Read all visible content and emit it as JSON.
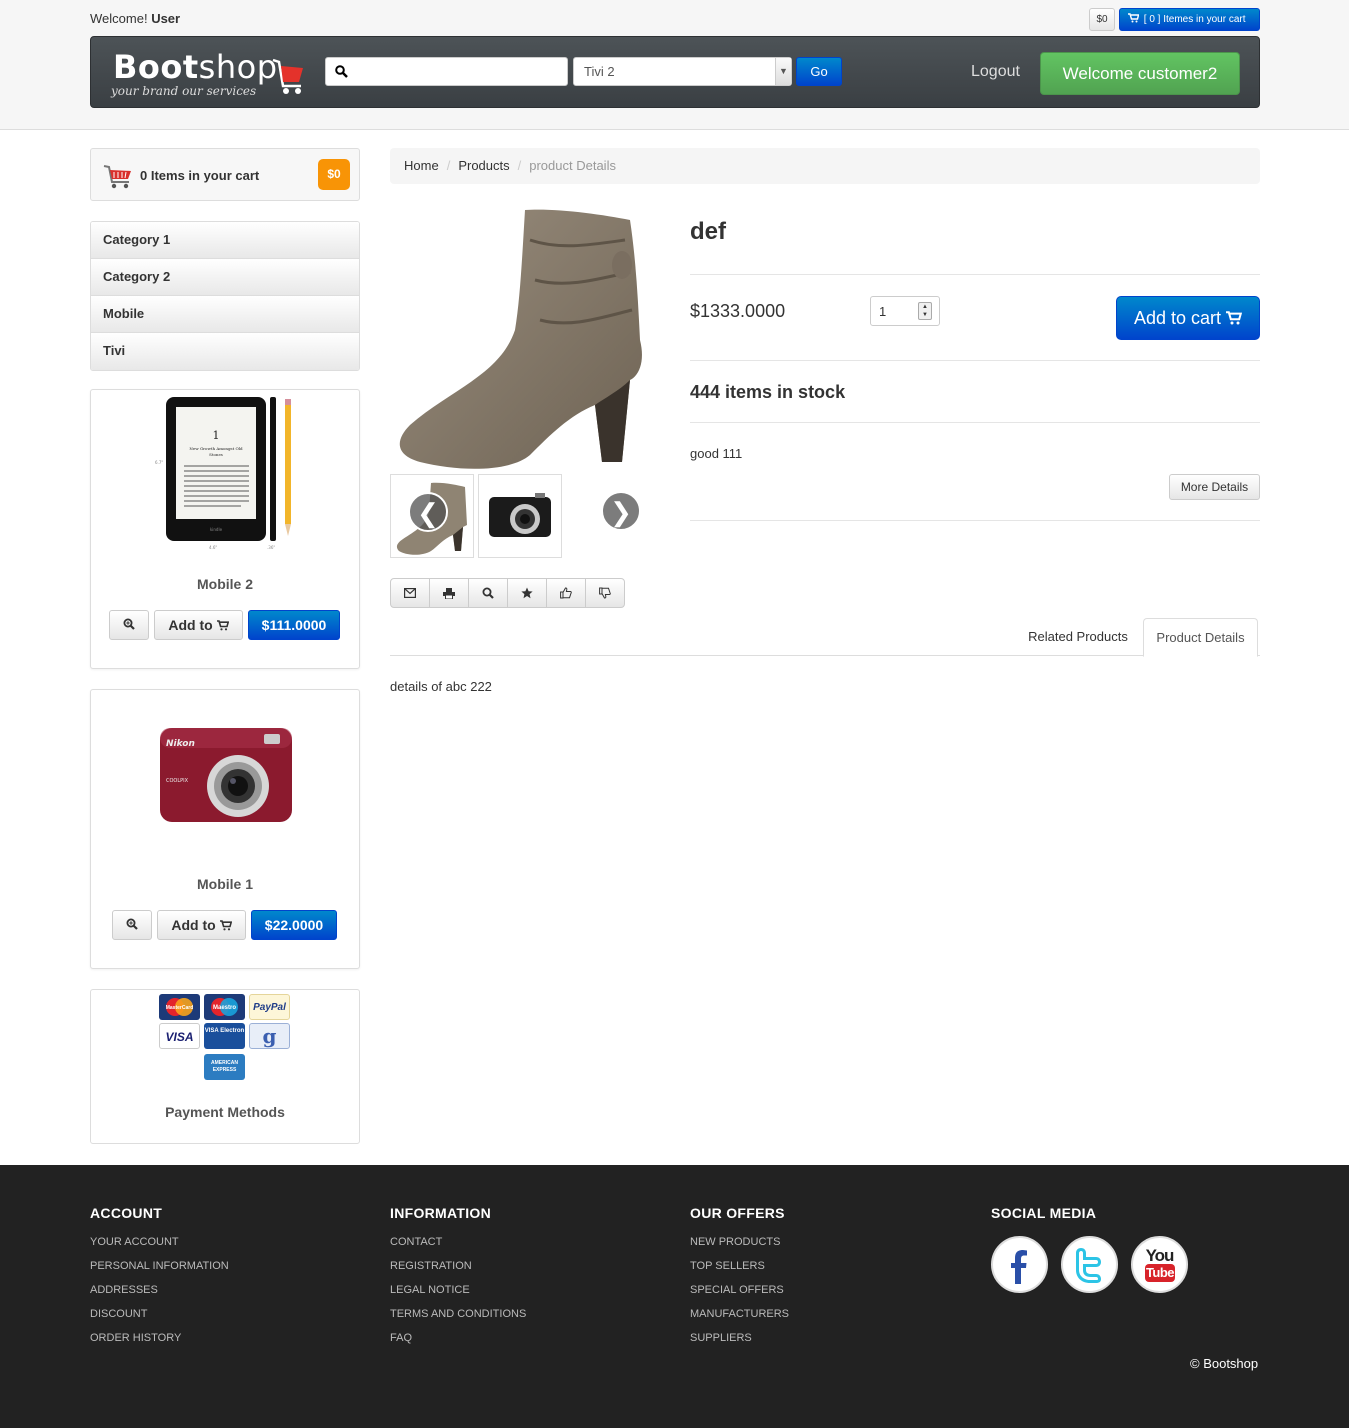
{
  "header": {
    "welcome_prefix": "Welcome!",
    "welcome_user": "User",
    "cart_total": "$0",
    "cart_button": "[ 0 ] Itemes in your cart",
    "logo_title_bold": "Boot",
    "logo_title_light": "shop",
    "logo_tagline": "your brand our services",
    "search_value": "",
    "category_selected": "Tivi 2",
    "go_label": "Go",
    "logout_label": "Logout",
    "welcome_button": "Welcome customer2"
  },
  "sidebar": {
    "cart_label": "0 Items in your cart",
    "cart_badge": "$0",
    "categories": [
      "Category 1",
      "Category 2",
      "Mobile",
      "Tivi"
    ],
    "products": [
      {
        "name": "Mobile 2",
        "add_label": "Add to",
        "price": "$111.0000"
      },
      {
        "name": "Mobile 1",
        "add_label": "Add to",
        "price": "$22.0000"
      }
    ],
    "payment_cards": [
      "MasterCard",
      "Maestro",
      "PayPal",
      "VISA",
      "VISA Electron",
      "g",
      "AMERICAN EXPRESS"
    ],
    "payment_label": "Payment Methods"
  },
  "breadcrumb": {
    "items": [
      "Home",
      "Products",
      "product Details"
    ]
  },
  "product": {
    "title": "def",
    "price": "$1333.0000",
    "quantity": "1",
    "add_to_cart": "Add to cart",
    "stock": "444 items in stock",
    "short_description": "good 111",
    "more_details": "More Details",
    "carousel_prev": "❮",
    "carousel_next": "❯",
    "actions": [
      "envelope-icon",
      "print-icon",
      "zoom-icon",
      "star-icon",
      "thumbs-up-icon",
      "thumbs-down-icon"
    ]
  },
  "tabs": {
    "related": "Related Products",
    "details": "Product Details",
    "active_content": "details of abc 222"
  },
  "footer": {
    "columns": [
      {
        "heading": "ACCOUNT",
        "links": [
          "YOUR ACCOUNT",
          "PERSONAL INFORMATION",
          "ADDRESSES",
          "DISCOUNT",
          "ORDER HISTORY"
        ]
      },
      {
        "heading": "INFORMATION",
        "links": [
          "CONTACT",
          "REGISTRATION",
          "LEGAL NOTICE",
          "TERMS AND CONDITIONS",
          "FAQ"
        ]
      },
      {
        "heading": "OUR OFFERS",
        "links": [
          "NEW PRODUCTS",
          "TOP SELLERS",
          "SPECIAL OFFERS",
          "MANUFACTURERS",
          "SUPPLIERS"
        ]
      }
    ],
    "social_heading": "SOCIAL MEDIA",
    "social": [
      "facebook-icon",
      "twitter-icon",
      "youtube-icon"
    ],
    "youtube_you": "You",
    "youtube_tube": "Tube",
    "copyright": "© Bootshop"
  },
  "colors": {
    "primary": "#0044cc",
    "success": "#51a351",
    "warning": "#f89406",
    "footer_bg": "#222222"
  }
}
